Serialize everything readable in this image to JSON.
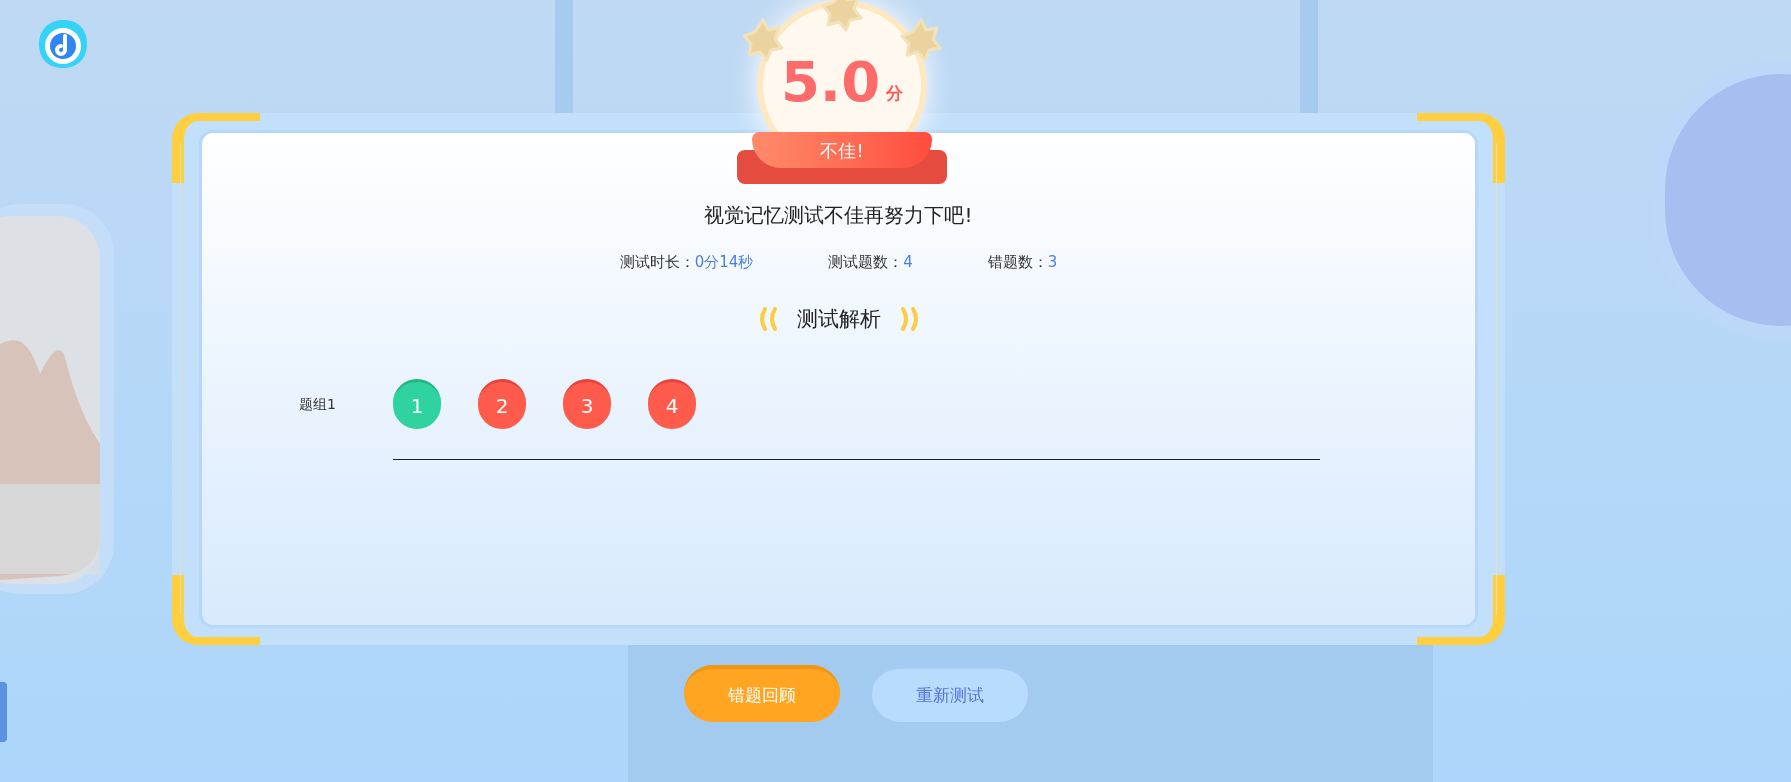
{
  "score": {
    "value": "5.0",
    "unit": "分",
    "verdict": "不佳!"
  },
  "message": "视觉记忆测试不佳再努力下吧!",
  "stats": [
    {
      "label": "测试时长：",
      "value": "0分14秒"
    },
    {
      "label": "测试题数：",
      "value": "4"
    },
    {
      "label": "错题数：",
      "value": "3"
    }
  ],
  "section_title": "测试解析",
  "groups": [
    {
      "label": "题组1",
      "questions": [
        {
          "number": "1",
          "correct": true
        },
        {
          "number": "2",
          "correct": false
        },
        {
          "number": "3",
          "correct": false
        },
        {
          "number": "4",
          "correct": false
        }
      ]
    }
  ],
  "buttons": [
    {
      "label": "错题回顾",
      "kind": "primary"
    },
    {
      "label": "重新测试",
      "kind": "secondary"
    }
  ]
}
